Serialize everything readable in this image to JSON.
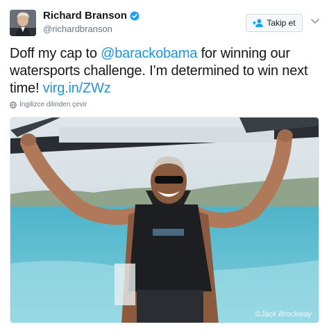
{
  "author": {
    "display_name": "Richard Branson",
    "handle": "@richardbranson",
    "verified": true,
    "avatar_icon": "profile-photo"
  },
  "follow_button": {
    "label": "Takip et",
    "icon": "add-user-icon"
  },
  "menu_icon": "chevron-down-icon",
  "tweet": {
    "text_1": "Doff my cap to ",
    "mention": "@barackobama",
    "text_2": " for winning our watersports challenge. I’m determined to win next time! ",
    "link": "virg.in/ZWz"
  },
  "translate_link": {
    "label": "İngilizce dilinden çevir",
    "icon": "globe-icon"
  },
  "media": {
    "type": "photo",
    "watermark": "©Jack Brockway"
  },
  "colors": {
    "link": "#1b95e0",
    "verified": "#1da1f2",
    "text": "#14171a",
    "muted": "#657786"
  }
}
